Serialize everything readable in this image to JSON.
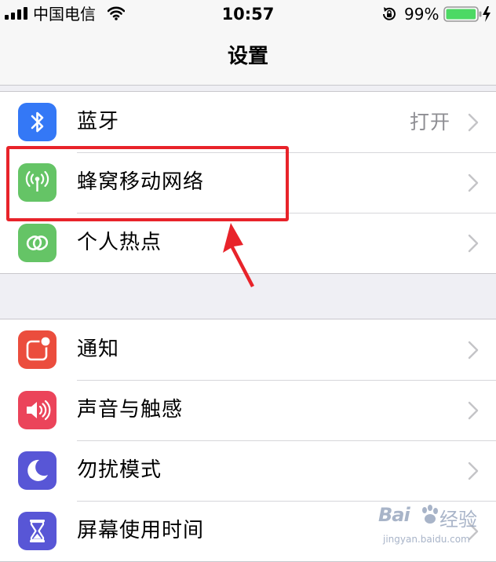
{
  "status_bar": {
    "carrier": "中国电信",
    "time": "10:57",
    "battery_percent": "99%",
    "battery_level": 0.99,
    "icons": [
      "signal-icon",
      "wifi-icon",
      "rotation-lock-icon",
      "battery-icon",
      "charging-icon"
    ]
  },
  "nav": {
    "title": "设置"
  },
  "groups": [
    {
      "rows": [
        {
          "label": "蓝牙",
          "value": "打开",
          "icon": "bluetooth-icon",
          "icon_color": "#3478f6"
        },
        {
          "label": "蜂窝移动网络",
          "value": "",
          "icon": "cellular-antenna-icon",
          "icon_color": "#65c466"
        },
        {
          "label": "个人热点",
          "value": "",
          "icon": "personal-hotspot-icon",
          "icon_color": "#65c466"
        }
      ]
    },
    {
      "rows": [
        {
          "label": "通知",
          "value": "",
          "icon": "notifications-icon",
          "icon_color": "#eb4d3d"
        },
        {
          "label": "声音与触感",
          "value": "",
          "icon": "speaker-icon",
          "icon_color": "#eb445a"
        },
        {
          "label": "勿扰模式",
          "value": "",
          "icon": "moon-icon",
          "icon_color": "#5856d6"
        },
        {
          "label": "屏幕使用时间",
          "value": "",
          "icon": "hourglass-icon",
          "icon_color": "#5856d6"
        }
      ]
    }
  ],
  "annotation": {
    "color": "#e8232a",
    "highlighted_row": "蜂窝移动网络"
  },
  "watermark": {
    "brand": "Bai",
    "brand_suffix": "经验",
    "domain": "jingyan.baidu.com"
  }
}
